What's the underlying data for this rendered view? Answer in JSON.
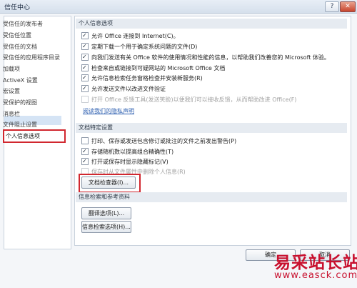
{
  "window": {
    "title": "信任中心",
    "help_glyph": "?",
    "close_glyph": "✕"
  },
  "sidebar": {
    "items": [
      {
        "label": "受信任的发布者"
      },
      {
        "label": "受信任位置"
      },
      {
        "label": "受信任的文档"
      },
      {
        "label": "受信任的应用程序目录"
      },
      {
        "label": "加载项"
      },
      {
        "label": "ActiveX 设置"
      },
      {
        "label": "宏设置"
      },
      {
        "label": "受保护的视图"
      },
      {
        "label": "消息栏"
      },
      {
        "label": "文件阻止设置"
      },
      {
        "label": "个人信息选项",
        "selected": true
      }
    ]
  },
  "privacy": {
    "header": "个人信息选项",
    "options": [
      {
        "label": "允许 Office 连接到 Internet(C)。",
        "checked": true,
        "enabled": true
      },
      {
        "label": "定期下载一个用于确定系统问题的文件(D)",
        "checked": true,
        "enabled": true
      },
      {
        "label": "向我们发送有关 Office 软件的使用情况和性能的信息，以帮助我们改善您的 Microsoft 体验。",
        "checked": true,
        "enabled": true
      },
      {
        "label": "检查来自或链接到可疑网站的 Microsoft Office 文档",
        "checked": true,
        "enabled": true
      },
      {
        "label": "允许信息检索任务窗格检查并安装新服务(R)",
        "checked": true,
        "enabled": true
      },
      {
        "label": "允许发送文件以改进文件验证",
        "checked": true,
        "enabled": true
      },
      {
        "label": "打开 Office 反馈工具(发送笑脸)以便我们可以接收反馈，从而帮助改进 Office(F)",
        "checked": false,
        "enabled": false
      }
    ],
    "link": "阅读我们的隐私声明"
  },
  "document_specific": {
    "header": "文档特定设置",
    "options": [
      {
        "label": "打印、保存或发送包含修订或批注的文件之前发出警告(P)",
        "checked": false,
        "enabled": true
      },
      {
        "label": "存储随机数以提高组合精确性(T)",
        "checked": true,
        "enabled": true
      },
      {
        "label": "打开或保存时显示隐藏标记(V)",
        "checked": true,
        "enabled": true
      },
      {
        "label": "保存时从文件属性中删除个人信息(R)",
        "checked": false,
        "enabled": false
      }
    ],
    "inspector_button": "文档检查器(I)..."
  },
  "research": {
    "header": "信息检索和参考资料",
    "translate_button": "翻译选项(L)...",
    "research_button": "信息检索选项(H)..."
  },
  "footer": {
    "ok": "确定",
    "cancel": "取消"
  },
  "watermark": {
    "site_name": "易采站长站",
    "url": "www.easck.com"
  }
}
